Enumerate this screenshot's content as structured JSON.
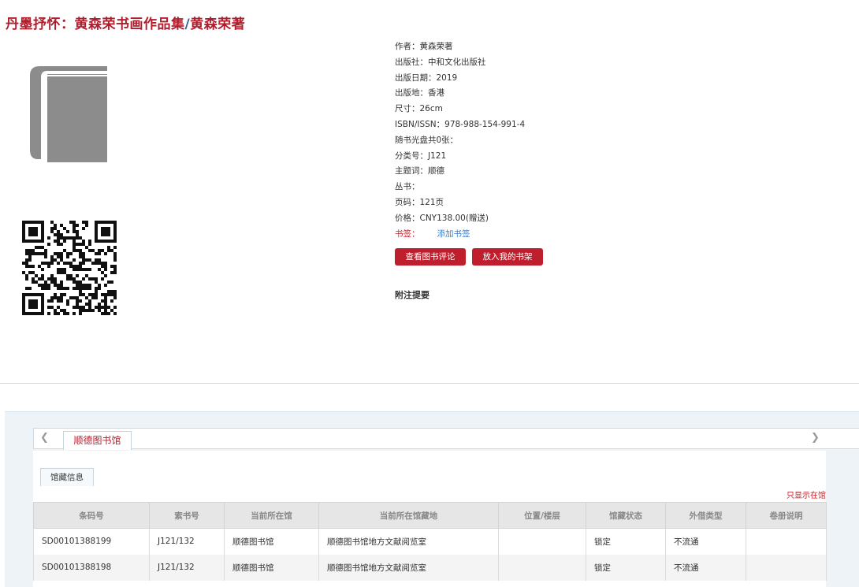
{
  "book": {
    "title": "丹墨抒怀：黄森荣书画作品集",
    "separator": "/",
    "author_resp": "黄森荣著"
  },
  "cover_icon": "book-icon",
  "qr_icon": "qr-code",
  "meta": [
    {
      "label": "作者：",
      "value": "黄森荣著"
    },
    {
      "label": "出版社：",
      "value": "中和文化出版社"
    },
    {
      "label": "出版日期：",
      "value": "2019"
    },
    {
      "label": "出版地：",
      "value": "香港"
    },
    {
      "label": "尺寸：",
      "value": "26cm"
    },
    {
      "label": "ISBN/ISSN：",
      "value": "978-988-154-991-4"
    },
    {
      "label": "随书光盘共0张：",
      "value": ""
    },
    {
      "label": "分类号：",
      "value": "J121"
    },
    {
      "label": "主题词：",
      "value": "顺德"
    },
    {
      "label": "丛书：",
      "value": ""
    },
    {
      "label": "页码：",
      "value": "121页"
    },
    {
      "label": "价格：",
      "value": "CNY138.00(赠送)"
    }
  ],
  "bookmark": {
    "label": "书签：",
    "link": "添加书签"
  },
  "buttons": {
    "review": "查看图书评论",
    "shelf": "放入我的书架"
  },
  "notes_title": "附注提要",
  "holdings": {
    "library_tab": "顺德图书馆",
    "sub_tab": "馆藏信息",
    "filter_link": "只显示在馆",
    "columns": [
      "条码号",
      "索书号",
      "当前所在馆",
      "当前所在馆藏地",
      "位置/楼层",
      "馆藏状态",
      "外借类型",
      "卷册说明"
    ],
    "rows": [
      [
        "SD00101388199",
        "J121/132",
        "顺德图书馆",
        "顺德图书馆地方文献阅览室",
        "",
        "锁定",
        "不流通",
        ""
      ],
      [
        "SD00101388198",
        "J121/132",
        "顺德图书馆",
        "顺德图书馆地方文献阅览室",
        "",
        "锁定",
        "不流通",
        ""
      ]
    ]
  }
}
